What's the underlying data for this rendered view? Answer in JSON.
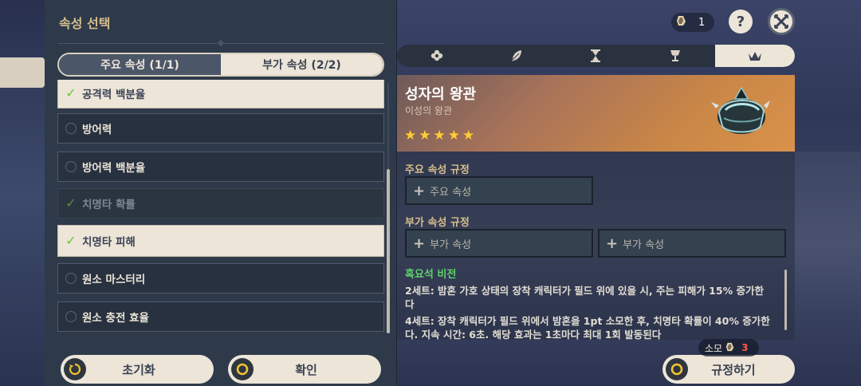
{
  "left_panel": {
    "title": "속성 선택",
    "tabs": [
      {
        "label": "주요 속성 (1/1)",
        "active": false
      },
      {
        "label": "부가 속성 (2/2)",
        "active": true
      }
    ],
    "items": [
      {
        "label": "공격력 백분율",
        "state": "selected"
      },
      {
        "label": "방어력",
        "state": "unchecked"
      },
      {
        "label": "방어력 백분율",
        "state": "unchecked"
      },
      {
        "label": "치명타 확률",
        "state": "disabled-checked"
      },
      {
        "label": "치명타 피해",
        "state": "selected"
      },
      {
        "label": "원소 마스터리",
        "state": "unchecked"
      },
      {
        "label": "원소 충전 효율",
        "state": "unchecked"
      }
    ],
    "reset_label": "초기화",
    "confirm_label": "확인"
  },
  "top_right": {
    "resin_count": "1",
    "help_label": "?",
    "close_icon": "close-icon"
  },
  "category_tabs": [
    {
      "icon": "flower-icon",
      "active": false
    },
    {
      "icon": "feather-icon",
      "active": false
    },
    {
      "icon": "hourglass-icon",
      "active": false
    },
    {
      "icon": "goblet-icon",
      "active": false
    },
    {
      "icon": "circlet-icon",
      "active": true
    }
  ],
  "artifact": {
    "name": "성자의 왕관",
    "set": "이성의 왕관",
    "stars": 5
  },
  "rules": {
    "main_label": "주요 속성 규정",
    "main_slot": "주요 속성",
    "sub_label": "부가 속성 규정",
    "sub_slots": [
      "부가 속성",
      "부가 속성"
    ]
  },
  "set_bonus": {
    "name": "흑요석 비전",
    "two_piece": "2세트: 밤혼 가호 상태의 장착 캐릭터가 필드 위에 있을 시, 주는 피해가 15% 증가한다",
    "four_piece": "4세트: 장착 캐릭터가 필드 위에서 밤혼을 1pt 소모한 후, 치명타 확률이 40% 증가한다. 지속 시간: 6초. 해당 효과는 1초마다 최대 1회 발동된다"
  },
  "footer": {
    "cost_label": "소모",
    "cost_value": "3",
    "apply_label": "규정하기"
  },
  "colors": {
    "accent_gold": "#d6bd8a",
    "check_green": "#6fc13a",
    "set_green": "#5fd16c",
    "cost_red": "#ff5a4a"
  }
}
